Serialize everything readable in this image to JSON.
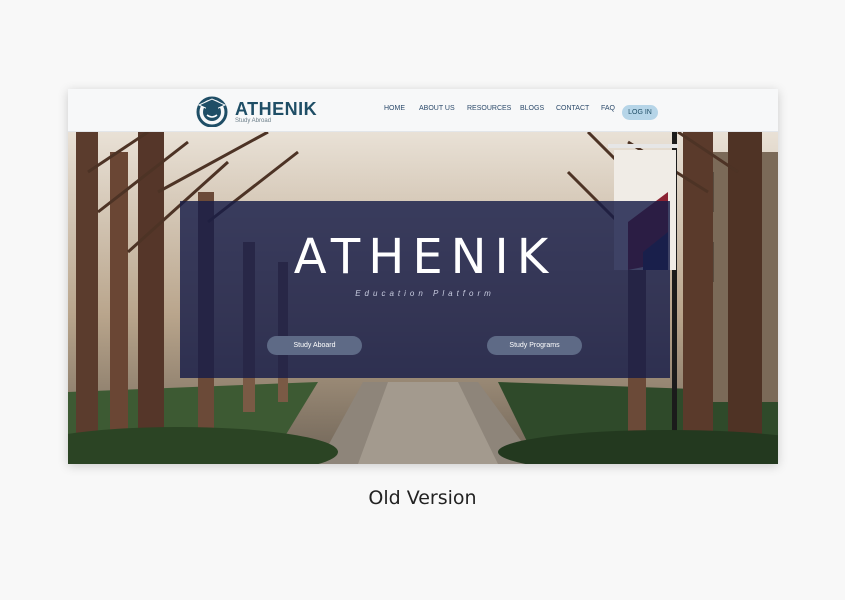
{
  "brand": {
    "name": "ATHENIK",
    "tagline": "Study Abroad"
  },
  "nav": {
    "items": [
      "HOME",
      "ABOUT US",
      "RESOURCES",
      "BLOGS",
      "CONTACT",
      "FAQ"
    ],
    "login_label": "LOG IN"
  },
  "hero": {
    "title": "ATHENIK",
    "subtitle": "Education Platform",
    "buttons": [
      "Study Aboard",
      "Study Programs"
    ]
  },
  "caption": "Old Version",
  "colors": {
    "brand": "#1f4e66",
    "overlay": "#161c48",
    "login_bg": "#b6d5e8",
    "button_bg": "#5e6a86"
  }
}
